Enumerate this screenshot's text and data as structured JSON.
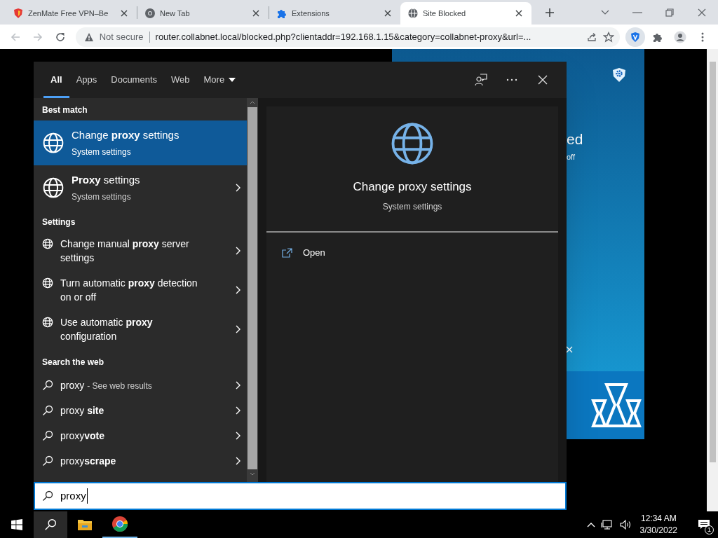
{
  "browser": {
    "tabs": [
      {
        "title": "ZenMate Free VPN–Be",
        "kind": "zenmate",
        "selected": false
      },
      {
        "title": "New Tab",
        "kind": "chrome",
        "selected": false
      },
      {
        "title": "Extensions",
        "kind": "puzzle",
        "selected": false
      },
      {
        "title": "Site Blocked",
        "kind": "globe",
        "selected": true
      }
    ],
    "address_bar": {
      "security": "Not secure",
      "url": "router.collabnet.local/blocked.php?clientaddr=192.168.1.15&category=collabnet-proxy&url=..."
    }
  },
  "page": {
    "banner": {
      "heading_fragment": "ed",
      "subtext_fragment": "off"
    }
  },
  "search": {
    "tabs": [
      {
        "label": "All",
        "selected": true
      },
      {
        "label": "Apps",
        "selected": false
      },
      {
        "label": "Documents",
        "selected": false
      },
      {
        "label": "Web",
        "selected": false
      },
      {
        "label": "More",
        "selected": false
      }
    ],
    "sections": [
      {
        "heading": "Best match",
        "items": [
          {
            "kind": "large",
            "title": "Change **proxy** settings",
            "subtitle": "System settings",
            "selected": true
          },
          {
            "kind": "large",
            "title": "**Proxy** settings",
            "subtitle": "System settings",
            "selected": false
          }
        ]
      },
      {
        "heading": "Settings",
        "items": [
          {
            "kind": "setting",
            "title": "Change manual **proxy** server settings",
            "selected": false
          },
          {
            "kind": "setting",
            "title": "Turn automatic **proxy** detection on or off",
            "selected": false
          },
          {
            "kind": "setting",
            "title": "Use automatic **proxy** configuration",
            "selected": false
          }
        ]
      },
      {
        "heading": "Search the web",
        "items": [
          {
            "kind": "web",
            "title": "proxy",
            "suffix": "- See web results",
            "selected": false
          },
          {
            "kind": "web",
            "title": "proxy **site**",
            "selected": false
          },
          {
            "kind": "web",
            "title": "proxy**vote**",
            "selected": false
          },
          {
            "kind": "web",
            "title": "proxy**scrape**",
            "selected": false
          }
        ]
      }
    ],
    "preview": {
      "title": "Change proxy settings",
      "subtitle": "System settings",
      "actions": [
        "Open"
      ]
    },
    "query": "proxy"
  },
  "taskbar": {
    "time": "12:34 AM",
    "date": "3/30/2022",
    "notifications": "1"
  }
}
